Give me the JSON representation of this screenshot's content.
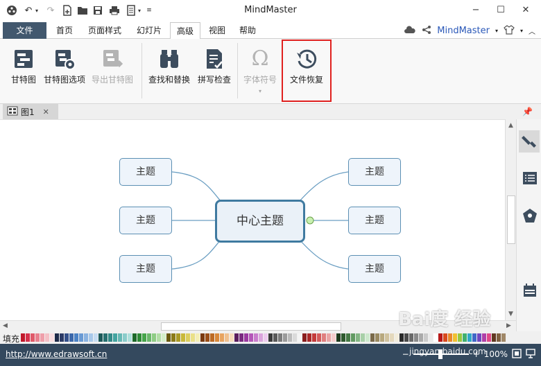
{
  "app": {
    "title": "MindMaster"
  },
  "window": {
    "minimize": "−",
    "maximize": "☐",
    "close": "✕"
  },
  "tabs": {
    "file": "文件",
    "items": [
      "首页",
      "页面样式",
      "幻灯片",
      "高级",
      "视图",
      "帮助"
    ],
    "active": "高级"
  },
  "account": {
    "name": "MindMaster"
  },
  "ribbon": {
    "gantt": "甘特图",
    "gantt_options": "甘特图选项",
    "export_gantt": "导出甘特图",
    "find_replace": "查找和替换",
    "spell_check": "拼写检查",
    "font_symbol": "字体符号",
    "file_restore": "文件恢复",
    "symbol_glyph": "Ω"
  },
  "document": {
    "tab_label": "图1"
  },
  "mindmap": {
    "central": "中心主题",
    "left_topics": [
      "主题",
      "主题",
      "主题"
    ],
    "right_topics": [
      "主题",
      "主题",
      "主题"
    ]
  },
  "palette": {
    "fill_label": "填充",
    "colors": [
      "#c0182b",
      "#d62f4a",
      "#e05a6a",
      "#e8808e",
      "#ef9faa",
      "#f4c0c6",
      "#f8dde0",
      "#1e2a48",
      "#2b3a66",
      "#34508a",
      "#3c68aa",
      "#4c82c4",
      "#6a9ad4",
      "#8ab2e0",
      "#a8c8ea",
      "#c6dcf2",
      "#1d5a5a",
      "#287070",
      "#348a88",
      "#44a4a0",
      "#66b8b4",
      "#8accca",
      "#aee0dc",
      "#1e6a2a",
      "#2e8a36",
      "#46a44a",
      "#6ab86a",
      "#8ecc84",
      "#b2dea6",
      "#d4eec8",
      "#6a5a10",
      "#8a7a18",
      "#aa9a26",
      "#c8b83a",
      "#dcce5e",
      "#eae088",
      "#f4eeb4",
      "#7a3a10",
      "#9a4e18",
      "#bc6a24",
      "#d8883a",
      "#e8a460",
      "#f0c08e",
      "#f6dcbc",
      "#5a1e5e",
      "#7a2a80",
      "#9a3aa0",
      "#b456b8",
      "#c87ccc",
      "#daa4dc",
      "#eccaee",
      "#3a3a3a",
      "#5a5a5a",
      "#7a7a7a",
      "#9a9a9a",
      "#bababa",
      "#dadada",
      "#f4f4f4",
      "#8a1e1e",
      "#aa2828",
      "#c43a3a",
      "#d45a5a",
      "#e07e7e",
      "#eaa4a4",
      "#f4cccc",
      "#1e3a1e",
      "#2e5a2e",
      "#467a46",
      "#629a62",
      "#84b684",
      "#a8d0a8",
      "#cce8cc",
      "#7a6a4a",
      "#9a8a62",
      "#b8a87e",
      "#d0c29e",
      "#e4d8bc",
      "#f2ecdc",
      "#2a2a2a",
      "#4a4a4a",
      "#6a6a6a",
      "#8a8a8a",
      "#aaaaaa",
      "#cacaca",
      "#eaeaea",
      "#ffffff",
      "#b81818",
      "#d84a1e",
      "#e8882a",
      "#f0c030",
      "#98c840",
      "#40b070",
      "#30a8c8",
      "#4068c8",
      "#7048c0",
      "#b040a8",
      "#e04888",
      "#603820",
      "#806040",
      "#a08868"
    ]
  },
  "status": {
    "url": "http://www.edrawsoft.cn",
    "zoom": "100%"
  },
  "watermark": {
    "main": "Bai度 经验",
    "sub": "jingyan.baidu.com"
  }
}
